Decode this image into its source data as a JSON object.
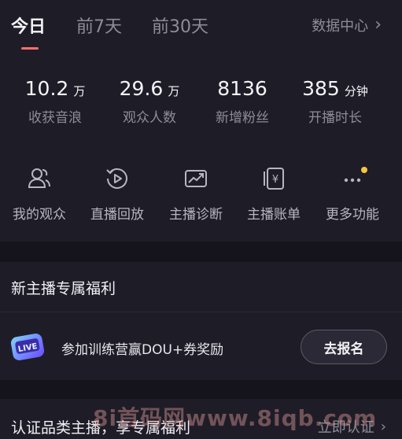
{
  "tabs": [
    {
      "label": "今日",
      "active": true
    },
    {
      "label": "前7天",
      "active": false
    },
    {
      "label": "前30天",
      "active": false
    }
  ],
  "data_center": {
    "label": "数据中心",
    "icon": "chevron-right-icon"
  },
  "stats": [
    {
      "value": "10.2",
      "unit": "万",
      "label": "收获音浪"
    },
    {
      "value": "29.6",
      "unit": "万",
      "label": "观众人数"
    },
    {
      "value": "8136",
      "unit": "",
      "label": "新增粉丝"
    },
    {
      "value": "385",
      "unit": "分钟",
      "label": "开播时长"
    }
  ],
  "tools": [
    {
      "label": "我的观众",
      "icon": "audience-icon"
    },
    {
      "label": "直播回放",
      "icon": "replay-icon"
    },
    {
      "label": "主播诊断",
      "icon": "diagnosis-icon"
    },
    {
      "label": "主播账单",
      "icon": "bill-icon"
    },
    {
      "label": "更多功能",
      "icon": "more-icon"
    }
  ],
  "welfare": {
    "title": "新主播专属福利",
    "badge_text": "LIVE",
    "task_text": "参加训练营赢DOU+券奖励",
    "button_label": "去报名"
  },
  "certification": {
    "text": "认证品类主播，享专属福利",
    "link_label": "立即认证"
  },
  "watermark": "8i首码网www.8iqb.com",
  "colors": {
    "background": "#15141c",
    "panel": "#1e1d27",
    "accent_underline": "#ff6e6e",
    "notification_dot": "#f5c542"
  }
}
